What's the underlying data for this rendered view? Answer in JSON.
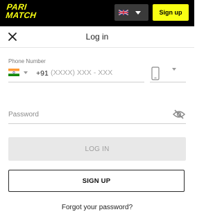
{
  "brand": {
    "logo_line1": "PARI",
    "logo_line2": "MATCH",
    "accent_color": "#f8ff13"
  },
  "topbar": {
    "language_icon": "uk-flag-icon",
    "signup_label": "Sign up"
  },
  "header": {
    "title": "Log in",
    "close_icon": "close-icon"
  },
  "form": {
    "phone_label": "Phone Number",
    "country_flag_icon": "india-flag-icon",
    "phone_prefix": "+91",
    "phone_placeholder": "(XXXX) XXX - XXX",
    "device_icon": "smartphone-icon",
    "password_placeholder": "Password",
    "password_toggle_icon": "eye-slash-icon"
  },
  "actions": {
    "login_label": "LOG IN",
    "signup_label": "SIGN UP",
    "forgot_label": "Forgot your password?"
  }
}
